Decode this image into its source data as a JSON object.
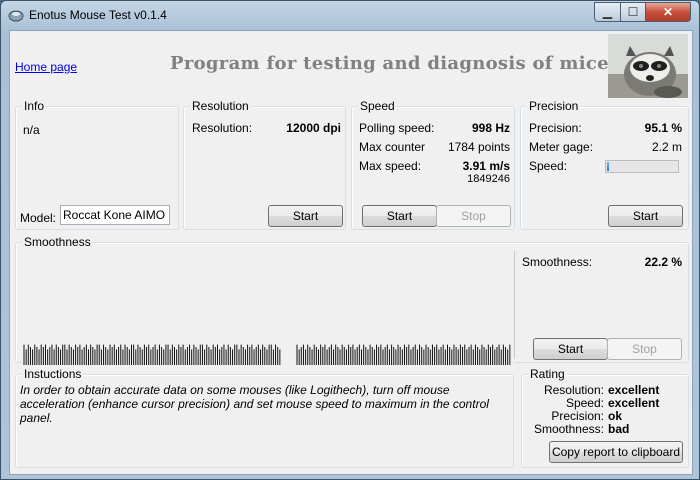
{
  "window": {
    "title": "Enotus Mouse Test v0.1.4"
  },
  "header": {
    "home_link": "Home page",
    "heading": "Program for testing and diagnosis of mice"
  },
  "info": {
    "title": "Info",
    "value": "n/a",
    "model_label": "Model:",
    "model_value": "Roccat Kone AIMO"
  },
  "resolution": {
    "title": "Resolution",
    "label": "Resolution:",
    "value": "12000 dpi",
    "start": "Start"
  },
  "speed": {
    "title": "Speed",
    "polling_label": "Polling speed:",
    "polling_value": "998 Hz",
    "counter_label": "Max counter",
    "counter_value": "1784 points",
    "max_speed_label": "Max  speed:",
    "max_speed_value": "3.91 m/s",
    "max_speed_sub": "1849246",
    "start": "Start",
    "stop": "Stop"
  },
  "precision": {
    "title": "Precision",
    "precision_label": "Precision:",
    "precision_value": "95.1 %",
    "gage_label": "Meter gage:",
    "gage_value": "2.2 m",
    "speed_label": "Speed:",
    "speed_fraction": 0.03,
    "start": "Start"
  },
  "smoothness": {
    "title": "Smoothness",
    "label": "Smoothness:",
    "value": "22.2 %",
    "start": "Start",
    "stop": "Stop",
    "graph_series": [
      [
        0.34,
        0.26,
        0.34,
        0.3,
        0.26,
        0.34,
        0.3,
        0.26,
        0.34,
        0.3,
        0.34,
        0.26,
        0.3,
        0.34,
        0.26,
        0.34,
        0.3,
        0.26,
        0.34,
        0.34,
        0.26,
        0.34,
        0.3,
        0.26,
        0.34,
        0.3,
        0.34,
        0.26,
        0.3,
        0.34,
        0.26,
        0.34,
        0.3,
        0.26,
        0.34,
        0.34,
        0.26,
        0.34,
        0.3,
        0.26,
        0.34,
        0.3,
        0.34,
        0.26,
        0.3,
        0.34,
        0.26,
        0.34,
        0.3,
        0.26,
        0.34,
        0.34,
        0.26,
        0.34,
        0.3,
        0.26,
        0.34,
        0.3,
        0.34,
        0.26,
        0.3,
        0.34,
        0.26,
        0.34,
        0.3,
        0.26,
        0.34,
        0.34,
        0.26,
        0.34,
        0.3,
        0.26,
        0.34,
        0.3,
        0.34,
        0.26,
        0.3,
        0.34,
        0.26,
        0.34,
        0.3,
        0.26,
        0.34,
        0.34,
        0.26,
        0.34,
        0.3,
        0.26,
        0.34,
        0.3,
        0.34,
        0.26,
        0.3,
        0.34,
        0.26,
        0.34,
        0.3,
        0.26,
        0.34,
        0.34,
        0.26,
        0.34,
        0.3,
        0.26,
        0.34,
        0.3,
        0.34,
        0.26,
        0.3,
        0.34,
        0.26,
        0.34,
        0.3,
        0.26,
        0.34,
        0.34,
        0.26,
        0.34,
        0.3,
        0.26
      ],
      [
        0.34,
        0.26,
        0.3,
        0.34,
        0.26,
        0.34,
        0.3,
        0.26,
        0.34,
        0.3,
        0.26,
        0.34,
        0.3,
        0.34,
        0.26,
        0.3,
        0.34,
        0.26,
        0.34,
        0.3,
        0.26,
        0.34,
        0.3,
        0.26,
        0.34,
        0.3,
        0.34,
        0.26,
        0.3,
        0.34,
        0.26,
        0.34,
        0.3,
        0.26,
        0.34,
        0.3,
        0.26,
        0.34,
        0.3,
        0.34,
        0.26,
        0.3,
        0.34,
        0.26,
        0.34,
        0.3,
        0.26,
        0.34,
        0.3,
        0.26,
        0.34,
        0.3,
        0.34,
        0.26,
        0.3,
        0.34,
        0.26,
        0.34,
        0.3,
        0.26,
        0.34,
        0.3,
        0.26,
        0.34,
        0.3,
        0.34,
        0.26,
        0.3,
        0.34,
        0.26,
        0.34,
        0.3,
        0.26,
        0.34,
        0.3,
        0.26,
        0.34,
        0.3,
        0.34,
        0.26,
        0.3,
        0.34,
        0.26,
        0.34,
        0.3,
        0.26,
        0.34,
        0.3,
        0.26,
        0.34,
        0.3,
        0.34,
        0.26,
        0.3,
        0.34,
        0.26,
        0.34,
        0.3,
        0.26,
        0.34
      ]
    ]
  },
  "instructions": {
    "title": "Instuctions",
    "text": "In order to obtain accurate data on some mouses (like Logithech), turn off mouse acceleration (enhance cursor precision) and set mouse speed to maximum in the control panel."
  },
  "rating": {
    "title": "Rating",
    "rows": [
      {
        "label": "Resolution:",
        "value": "excellent"
      },
      {
        "label": "Speed:",
        "value": "excellent"
      },
      {
        "label": "Precision:",
        "value": "ok"
      },
      {
        "label": "Smoothness:",
        "value": "bad"
      }
    ],
    "copy_button": "Copy report to clipboard"
  },
  "colors": {
    "link": "#0000ee",
    "close_button": "#c7503c",
    "progress": "#1f7be0"
  }
}
